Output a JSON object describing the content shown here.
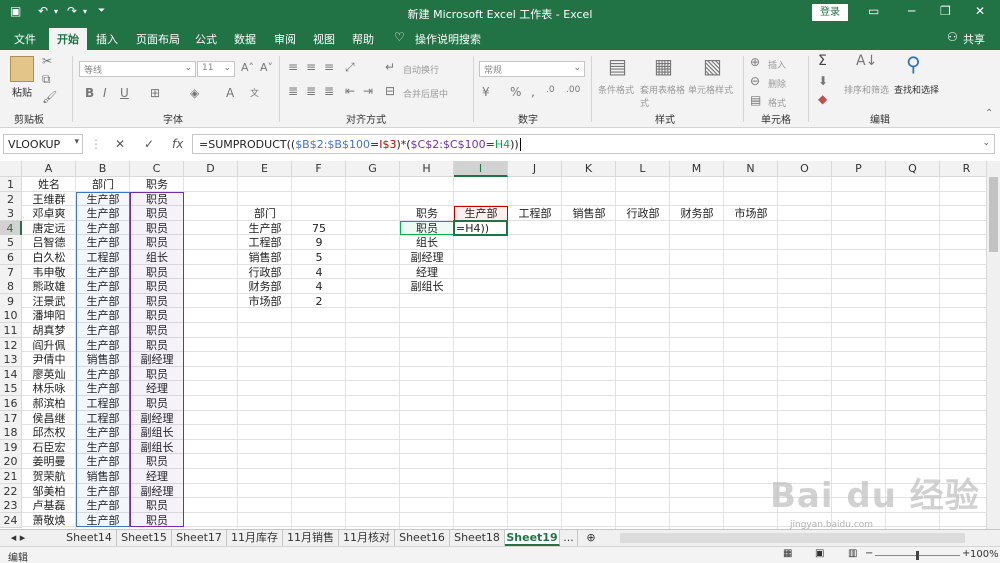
{
  "titlebar": {
    "title": "新建 Microsoft Excel 工作表 - Excel",
    "login": "登录",
    "bg": "#217346"
  },
  "tabs": [
    {
      "label": "文件",
      "active": false
    },
    {
      "label": "开始",
      "active": true
    },
    {
      "label": "插入",
      "active": false
    },
    {
      "label": "页面布局",
      "active": false
    },
    {
      "label": "公式",
      "active": false
    },
    {
      "label": "数据",
      "active": false
    },
    {
      "label": "审阅",
      "active": false
    },
    {
      "label": "视图",
      "active": false
    },
    {
      "label": "帮助",
      "active": false
    }
  ],
  "tell_me": "操作说明搜索",
  "share": "共享",
  "ribbon": {
    "paste": "粘贴",
    "clipboard": "剪贴板",
    "font_group": "字体",
    "font_name": "等线",
    "font_size": "11",
    "align_group": "对齐方式",
    "wrap": "自动换行",
    "merge": "合并后居中",
    "number_group": "数字",
    "number_format": "常规",
    "styles_group": "样式",
    "cond_format": "条件格式",
    "table_format": "套用表格格式",
    "cell_style": "单元格样式",
    "cells_group": "单元格",
    "insert": "插入",
    "delete": "删除",
    "format": "格式",
    "edit_group": "编辑",
    "sort_filter": "排序和筛选",
    "find_select": "查找和选择"
  },
  "formula_bar": {
    "name_box": "VLOOKUP",
    "prefix": "=SUMPRODUCT((",
    "ref1": "$B$2:$B$100",
    "eq1": "=",
    "ref2": "I$3",
    "mid": ")*(",
    "ref3": "$C$2:$C$100",
    "eq2": "=",
    "ref4": "H4",
    "suffix": "))",
    "ref1_color": "#4472c4",
    "ref2_color": "#c00000",
    "ref3_color": "#7030a0",
    "ref4_color": "#00b050"
  },
  "columns": [
    "A",
    "B",
    "C",
    "D",
    "E",
    "F",
    "G",
    "H",
    "I",
    "J",
    "K",
    "L",
    "M",
    "N",
    "O",
    "P",
    "Q",
    "R"
  ],
  "rows": [
    "1",
    "2",
    "3",
    "4",
    "5",
    "6",
    "7",
    "8",
    "9",
    "10",
    "11",
    "12",
    "13",
    "14",
    "15",
    "16",
    "17",
    "18",
    "19",
    "20",
    "21",
    "22",
    "23",
    "24"
  ],
  "table_a": {
    "headers": [
      "姓名",
      "部门",
      "职务"
    ],
    "records": [
      [
        "王维群",
        "生产部",
        "职员"
      ],
      [
        "邓卓爽",
        "生产部",
        "职员"
      ],
      [
        "唐定远",
        "生产部",
        "职员"
      ],
      [
        "吕智德",
        "生产部",
        "职员"
      ],
      [
        "白久松",
        "工程部",
        "组长"
      ],
      [
        "韦申敬",
        "生产部",
        "职员"
      ],
      [
        "熊政雄",
        "生产部",
        "职员"
      ],
      [
        "汪景武",
        "生产部",
        "职员"
      ],
      [
        "潘坤阳",
        "生产部",
        "职员"
      ],
      [
        "胡真梦",
        "生产部",
        "职员"
      ],
      [
        "阎升佩",
        "生产部",
        "职员"
      ],
      [
        "尹倩中",
        "销售部",
        "副经理"
      ],
      [
        "廖英灿",
        "生产部",
        "职员"
      ],
      [
        "林乐咏",
        "生产部",
        "经理"
      ],
      [
        "郝滨柏",
        "工程部",
        "职员"
      ],
      [
        "侯昌继",
        "工程部",
        "副经理"
      ],
      [
        "邱杰权",
        "生产部",
        "副组长"
      ],
      [
        "石臣宏",
        "生产部",
        "副组长"
      ],
      [
        "姜明曼",
        "生产部",
        "职员"
      ],
      [
        "贺荣航",
        "销售部",
        "经理"
      ],
      [
        "邹美柏",
        "生产部",
        "副经理"
      ],
      [
        "卢基磊",
        "生产部",
        "职员"
      ],
      [
        "萧敬焕",
        "生产部",
        "职员"
      ]
    ]
  },
  "dept_table": {
    "header": "部门",
    "items": [
      {
        "name": "生产部",
        "count": "75"
      },
      {
        "name": "工程部",
        "count": "9"
      },
      {
        "name": "销售部",
        "count": "5"
      },
      {
        "name": "行政部",
        "count": "4"
      },
      {
        "name": "财务部",
        "count": "4"
      },
      {
        "name": "市场部",
        "count": "2"
      }
    ]
  },
  "matrix": {
    "corner": "职务",
    "depts": [
      "生产部",
      "工程部",
      "销售部",
      "行政部",
      "财务部",
      "市场部"
    ],
    "roles": [
      "职员",
      "组长",
      "副经理",
      "经理",
      "副组长"
    ],
    "editing_text": "=H4))"
  },
  "sheets": [
    "Sheet14",
    "Sheet15",
    "Sheet17",
    "11月库存",
    "11月销售",
    "11月核对",
    "Sheet16",
    "Sheet18",
    "Sheet19",
    "..."
  ],
  "active_sheet": "Sheet19",
  "status": {
    "mode": "编辑",
    "zoom": "100%"
  },
  "watermark": {
    "text": "Bai du 经验",
    "sub": "jingyan.baidu.com"
  }
}
